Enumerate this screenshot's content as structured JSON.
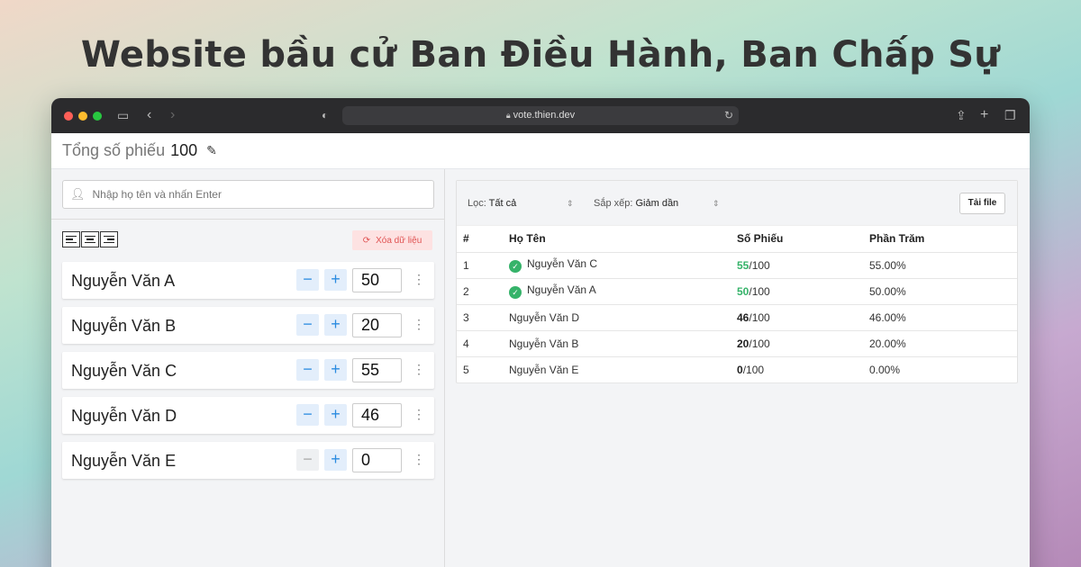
{
  "headline": "Website bầu cử Ban Điều Hành, Ban Chấp Sự",
  "browser": {
    "url": "vote.thien.dev"
  },
  "topbar": {
    "total_label": "Tổng số phiếu",
    "total_value": "100"
  },
  "search": {
    "placeholder": "Nhập họ tên và nhấn Enter"
  },
  "toolbar": {
    "clear_label": "Xóa dữ liệu"
  },
  "candidates": [
    {
      "name": "Nguyễn Văn A",
      "votes": "50"
    },
    {
      "name": "Nguyễn Văn B",
      "votes": "20"
    },
    {
      "name": "Nguyễn Văn C",
      "votes": "55"
    },
    {
      "name": "Nguyễn Văn D",
      "votes": "46"
    },
    {
      "name": "Nguyễn Văn E",
      "votes": "0"
    }
  ],
  "results": {
    "filter_label": "Lọc:",
    "filter_value": "Tất cả",
    "sort_label": "Sắp xếp:",
    "sort_value": "Giảm dần",
    "download_label": "Tải file",
    "headers": [
      "#",
      "Họ Tên",
      "Số Phiếu",
      "Phần Trăm"
    ],
    "rows": [
      {
        "rank": "1",
        "name": "Nguyễn Văn C",
        "votes": "55",
        "total": "/100",
        "percent": "55.00%",
        "elected": true
      },
      {
        "rank": "2",
        "name": "Nguyễn Văn A",
        "votes": "50",
        "total": "/100",
        "percent": "50.00%",
        "elected": true
      },
      {
        "rank": "3",
        "name": "Nguyễn Văn D",
        "votes": "46",
        "total": "/100",
        "percent": "46.00%",
        "elected": false
      },
      {
        "rank": "4",
        "name": "Nguyễn Văn B",
        "votes": "20",
        "total": "/100",
        "percent": "20.00%",
        "elected": false
      },
      {
        "rank": "5",
        "name": "Nguyễn Văn E",
        "votes": "0",
        "total": "/100",
        "percent": "0.00%",
        "elected": false
      }
    ]
  },
  "colors": {
    "accent": "#2a8be0",
    "elected": "#36b36a",
    "danger": "#e05252"
  }
}
